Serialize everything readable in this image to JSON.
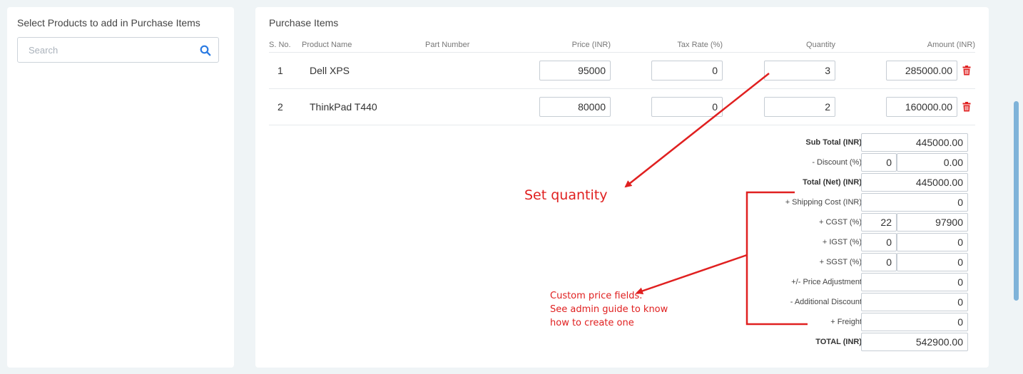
{
  "left_panel": {
    "title": "Select Products to add in Purchase Items",
    "search": {
      "placeholder": "Search",
      "value": ""
    }
  },
  "items_panel": {
    "title": "Purchase Items",
    "columns": [
      "S. No.",
      "Product Name",
      "Part Number",
      "Price (INR)",
      "Tax Rate (%)",
      "Quantity",
      "Amount (INR)"
    ],
    "rows": [
      {
        "sno": "1",
        "product": "Dell XPS",
        "part_number": "",
        "price": "95000",
        "tax_rate": "0",
        "quantity": "3",
        "amount": "285000.00"
      },
      {
        "sno": "2",
        "product": "ThinkPad T440",
        "part_number": "",
        "price": "80000",
        "tax_rate": "0",
        "quantity": "2",
        "amount": "160000.00"
      }
    ]
  },
  "totals": {
    "sub_total": {
      "label": "Sub Total (INR)",
      "value": "445000.00"
    },
    "discount": {
      "label": "- Discount (%)",
      "percent": "0",
      "value": "0.00"
    },
    "total_net": {
      "label": "Total (Net) (INR)",
      "value": "445000.00"
    },
    "shipping": {
      "label": "+ Shipping Cost (INR)",
      "value": "0"
    },
    "cgst": {
      "label": "+ CGST (%)",
      "percent": "22",
      "value": "97900"
    },
    "igst": {
      "label": "+ IGST (%)",
      "percent": "0",
      "value": "0"
    },
    "sgst": {
      "label": "+ SGST (%)",
      "percent": "0",
      "value": "0"
    },
    "price_adjustment": {
      "label": "+/- Price Adjustment",
      "value": "0"
    },
    "additional_discount": {
      "label": "- Additional Discount",
      "value": "0"
    },
    "freight": {
      "label": "+ Freight",
      "value": "0"
    },
    "grand_total": {
      "label": "TOTAL (INR)",
      "value": "542900.00"
    }
  },
  "annotations": {
    "set_quantity": "Set quantity",
    "custom_fields_line1": "Custom price fields.",
    "custom_fields_line2": "See admin guide to know",
    "custom_fields_line3": "how to create one"
  },
  "colors": {
    "background": "#eff4f6",
    "panel": "#ffffff",
    "annotation": "#e02020",
    "delete_icon": "#e02020",
    "search_icon": "#2a7ae2",
    "scrollbar": "#7fb3d9"
  },
  "icons": {
    "search": "search-icon",
    "delete": "trash-icon"
  }
}
